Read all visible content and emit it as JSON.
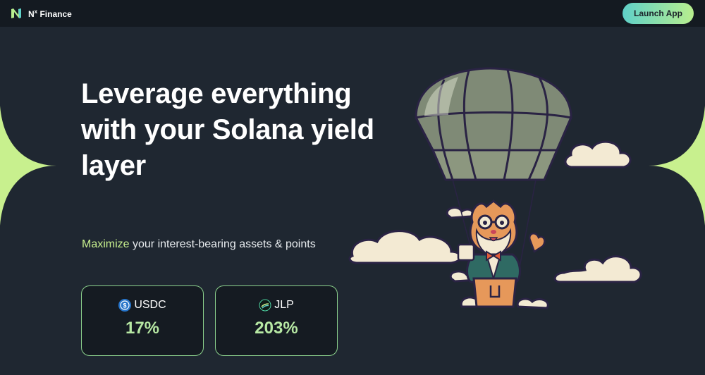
{
  "nav": {
    "brand_prefix": "N",
    "brand_sup": "x",
    "brand_suffix": " Finance",
    "logo_icon": "nx-logo-icon",
    "launch_label": "Launch App"
  },
  "hero": {
    "title": "Leverage everything with your Solana yield layer",
    "subtitle_accent": "Maximize",
    "subtitle_rest": " your interest-bearing assets & points"
  },
  "stats": [
    {
      "token": "USDC",
      "icon": "usdc-icon",
      "value": "17%"
    },
    {
      "token": "JLP",
      "icon": "jlp-icon",
      "value": "203%"
    }
  ],
  "colors": {
    "background": "#1f2731",
    "topbar": "#141a21",
    "accent_green": "#c8f08e",
    "accent_teal": "#5fd0c8",
    "card_border": "#8bd18c"
  }
}
